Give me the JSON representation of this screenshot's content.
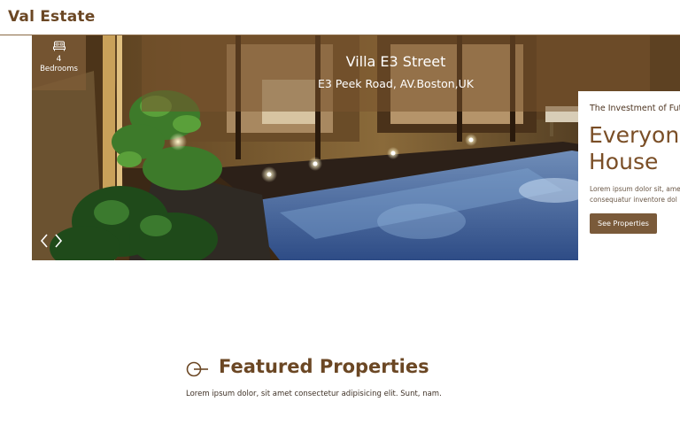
{
  "brand": {
    "name": "Val Estate"
  },
  "hero": {
    "bedrooms": {
      "count": "4",
      "label": "Bedrooms",
      "icon": "bed-icon"
    },
    "title": "Villa E3 Street",
    "address": "E3 Peek Road, AV.Boston,UK",
    "prev_icon": "chevron-left-icon",
    "next_icon": "chevron-right-icon"
  },
  "promo": {
    "kicker": "The Investment of Fut",
    "headline_line1": "Everyonc",
    "headline_line2": "House",
    "text_line1": "Lorem ipsum dolor sit, ame",
    "text_line2": "consequatur inventore dol",
    "button_label": "See Properties"
  },
  "featured": {
    "title": "Featured Properties",
    "subtitle": "Lorem ipsum dolor, sit amet consectetur adipisicing elit. Sunt, nam.",
    "icon": "key-icon"
  },
  "colors": {
    "brand": "#6b4724",
    "button": "#7a5a3a",
    "overlay": "#7e5c37"
  }
}
